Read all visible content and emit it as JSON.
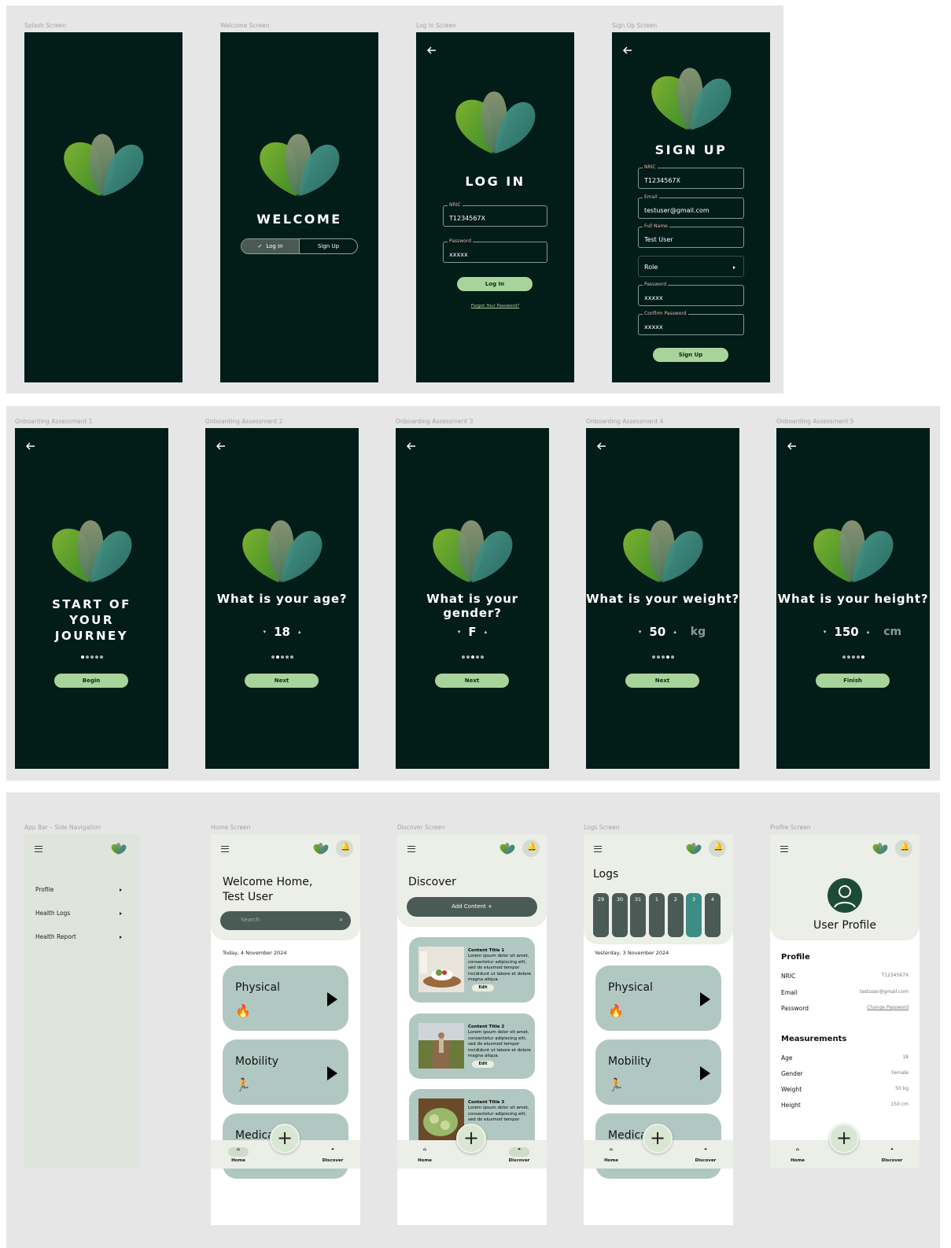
{
  "screens": {
    "splash": {
      "label": "Splash Screen"
    },
    "welcome": {
      "label": "Welcome Screen",
      "title": "WELCOME",
      "login_tab": "Log In",
      "signup_tab": "Sign Up"
    },
    "login": {
      "label": "Log In Screen",
      "title": "LOG IN",
      "nric_label": "NRIC",
      "nric_value": "T1234567X",
      "password_label": "Password",
      "password_value": "xxxxx",
      "button": "Log In",
      "forgot": "Forgot Your Password?"
    },
    "signup": {
      "label": "Sign Up Screen",
      "title": "SIGN UP",
      "nric_label": "NRIC",
      "nric_value": "T1234567X",
      "email_label": "Email",
      "email_value": "testuser@gmail.com",
      "name_label": "Full Name",
      "name_value": "Test User",
      "role": "Role",
      "password_label": "Password",
      "password_value": "xxxxx",
      "confirm_label": "Confirm Password",
      "confirm_value": "xxxxx",
      "button": "Sign Up"
    },
    "onboard1": {
      "label": "Onboarding Assessment 1",
      "line1": "START OF",
      "line2": "YOUR",
      "line3": "JOURNEY",
      "button": "Begin",
      "step": 1
    },
    "onboard2": {
      "label": "Onboarding Assessment 2",
      "question": "What is your age?",
      "value": "18",
      "button": "Next",
      "step": 2
    },
    "onboard3": {
      "label": "Onboarding Assessment 3",
      "question": "What is your gender?",
      "value": "F",
      "button": "Next",
      "step": 3
    },
    "onboard4": {
      "label": "Onboarding Assessment 4",
      "question": "What is your weight?",
      "value": "50",
      "unit": "kg",
      "button": "Next",
      "step": 4
    },
    "onboard5": {
      "label": "Onboarding Assessment 5",
      "question": "What is your height?",
      "value": "150",
      "unit": "cm",
      "button": "Finish",
      "step": 5
    },
    "sidenav": {
      "label": "App Bar – Side Navigation",
      "items": [
        "Profile",
        "Health Logs",
        "Health Report"
      ]
    },
    "home": {
      "label": "Home Screen",
      "welcome_line1": "Welcome Home,",
      "welcome_line2": "Test User",
      "search_placeholder": "Search",
      "date": "Today, 4 November 2024",
      "cards": [
        "Physical",
        "Mobility",
        "Medica"
      ]
    },
    "discover": {
      "label": "Discover Screen",
      "title": "Discover",
      "add_button": "Add Content +",
      "items": [
        {
          "title": "Content Title 1",
          "text": "Lorem ipsum dolor sit amet, consectetur adipiscing elit, sed do eiusmod tempor incididunt ut labore et dolore magna aliqua.",
          "edit": "Edit"
        },
        {
          "title": "Content Title 2",
          "text": "Lorem ipsum dolor sit amet, consectetur adipiscing elit, sed do eiusmod tempor incididunt ut labore et dolore magna aliqua.",
          "edit": "Edit"
        },
        {
          "title": "Content Title 3",
          "text": "Lorem ipsum dolor sit amet, consectetur adipiscing elit, sed do eiusmod tempor",
          "edit": ""
        }
      ]
    },
    "logs": {
      "label": "Logs Screen",
      "title": "Logs",
      "days": [
        "29",
        "30",
        "31",
        "1",
        "2",
        "3",
        "4"
      ],
      "selected_day": "3",
      "date": "Yesterday, 3 November 2024",
      "cards": [
        "Physical",
        "Mobility",
        "Medica"
      ]
    },
    "profile": {
      "label": "Profile Screen",
      "title": "User Profile",
      "section1": "Profile",
      "rows1": [
        {
          "k": "NRIC",
          "v": "T1234567X"
        },
        {
          "k": "Email",
          "v": "testuser@gmail.com"
        },
        {
          "k": "Password",
          "v": "Change Password"
        }
      ],
      "section2": "Measurements",
      "rows2": [
        {
          "k": "Age",
          "v": "18"
        },
        {
          "k": "Gender",
          "v": "Female"
        },
        {
          "k": "Weight",
          "v": "50 kg"
        },
        {
          "k": "Height",
          "v": "150 cm"
        }
      ]
    }
  },
  "nav": {
    "home": "Home",
    "discover": "Discover",
    "fab": "+"
  },
  "colors": {
    "dark_bg": "#021c18",
    "accent_green": "#a8d49b",
    "card_teal": "#b1c8c2",
    "light_bar": "#eceee8"
  }
}
